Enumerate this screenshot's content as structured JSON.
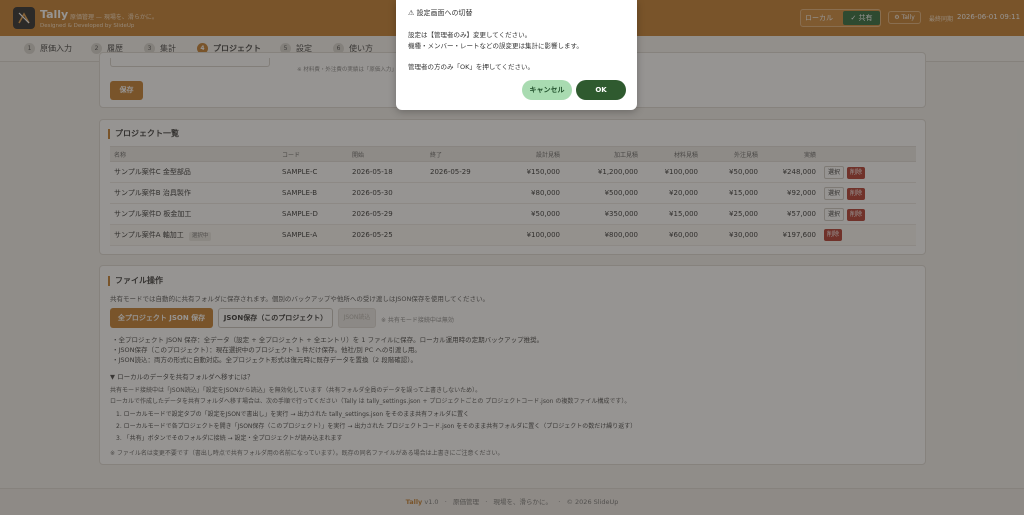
{
  "header": {
    "app_name": "Tally",
    "subtitle": "原価管理 — 現場を、滑らかに。",
    "credit": "Designed & Developed by SlideUp",
    "mode_local": "ローカル",
    "mode_shared": "✓ 共有",
    "user_badge": "⚙ Tally",
    "updated_label": "最終同期",
    "updated_time": "2026-06-01 09:11"
  },
  "tabs": [
    {
      "num": "1",
      "label": "原価入力"
    },
    {
      "num": "2",
      "label": "履歴"
    },
    {
      "num": "3",
      "label": "集計"
    },
    {
      "num": "4",
      "label": "プロジェクト"
    },
    {
      "num": "5",
      "label": "設定"
    },
    {
      "num": "6",
      "label": "使い方"
    }
  ],
  "top_card": {
    "hint": "※ 材料費・外注費の実績は「原価入力」",
    "save_button": "保存"
  },
  "projects": {
    "title": "プロジェクト一覧",
    "columns": [
      "名称",
      "コード",
      "開始",
      "終了",
      "設計見積",
      "加工見積",
      "材料見積",
      "外注見積",
      "実績",
      ""
    ],
    "rows": [
      {
        "name": "サンプル案件C 金型部品",
        "code": "SAMPLE-C",
        "start": "2026-05-18",
        "end": "2026-05-29",
        "design": "¥150,000",
        "machining": "¥1,200,000",
        "material": "¥100,000",
        "outsource": "¥50,000",
        "actual": "¥248,000",
        "select": "選択",
        "delete": "削除",
        "tag": ""
      },
      {
        "name": "サンプル案件B 治具製作",
        "code": "SAMPLE-B",
        "start": "2026-05-30",
        "end": "",
        "design": "¥80,000",
        "machining": "¥500,000",
        "material": "¥20,000",
        "outsource": "¥15,000",
        "actual": "¥92,000",
        "select": "選択",
        "delete": "削除",
        "tag": ""
      },
      {
        "name": "サンプル案件D 板金加工",
        "code": "SAMPLE-D",
        "start": "2026-05-29",
        "end": "",
        "design": "¥50,000",
        "machining": "¥350,000",
        "material": "¥15,000",
        "outsource": "¥25,000",
        "actual": "¥57,000",
        "select": "選択",
        "delete": "削除",
        "tag": ""
      },
      {
        "name": "サンプル案件A 軸加工",
        "code": "SAMPLE-A",
        "start": "2026-05-25",
        "end": "",
        "design": "¥100,000",
        "machining": "¥800,000",
        "material": "¥60,000",
        "outsource": "¥30,000",
        "actual": "¥197,600",
        "select": "",
        "delete": "削除",
        "tag": "選択中"
      }
    ]
  },
  "file_ops": {
    "title": "ファイル操作",
    "description": "共有モードでは自動的に共有フォルダに保存されます。個別のバックアップや他所への受け渡しはJSON保存を使用してください。",
    "btn_all_json": "全プロジェクト JSON 保存",
    "btn_json_this": "JSON保存（このプロジェクト）",
    "btn_json_load": "JSON読込",
    "load_disabled_note": "※ 共有モード接続中は無効",
    "bullets": [
      "・全プロジェクト JSON 保存：全データ（設定 + 全プロジェクト + 全エントリ）を 1 ファイルに保存。ローカル運用時の定期バックアップ推奨。",
      "・JSON保存（このプロジェクト）：現在選択中のプロジェクト 1 件だけ保存。他社/別 PC への引渡し用。",
      "・JSON読込：両方の形式に自動対応。全プロジェクト形式は復元時に既存データを置換（2 段階確認）。"
    ],
    "details_summary": "▼ ローカルのデータを共有フォルダへ移すには？",
    "details_p1": "共有モード接続中は「JSON読込」「設定をJSONから読込」を無効化しています（共有フォルダ全員のデータを誤って上書きしないため）。",
    "details_p2": "ローカルで作成したデータを共有フォルダへ移す場合は、次の手順で行ってください（Tally は tally_settings.json + プロジェクトごとの プロジェクトコード.json の複数ファイル構成です）。",
    "steps": [
      "1. ローカルモードで設定タブの「設定をJSONで書出し」を実行 → 出力された tally_settings.json をそのまま共有フォルダに置く",
      "2. ローカルモードで各プロジェクトを開き「JSON保存（このプロジェクト）」を実行 → 出力された プロジェクトコード.json をそのまま共有フォルダに置く（プロジェクトの数だけ繰り返す）",
      "3. 「共有」ボタンでそのフォルダに接続 → 設定・全プロジェクトが読み込まれます"
    ],
    "footnote": "※ ファイル名は変更不要です（書出し時点で共有フォルダ用の名前になっています）。既存の同名ファイルがある場合は上書きにご注意ください。"
  },
  "footer": {
    "brand": "Tally",
    "version": "v1.0",
    "product": "原価管理",
    "tagline": "現場を、滑らかに。",
    "copyright": "© 2026 SlideUp"
  },
  "modal": {
    "title": "⚠ 設定画面への切替",
    "line1": "設定は【管理者のみ】変更してください。",
    "line2": "機種・メンバー・レートなどの誤変更は集計に影響します。",
    "line3": "管理者の方のみ「OK」を押してください。",
    "cancel": "キャンセル",
    "ok": "OK"
  }
}
